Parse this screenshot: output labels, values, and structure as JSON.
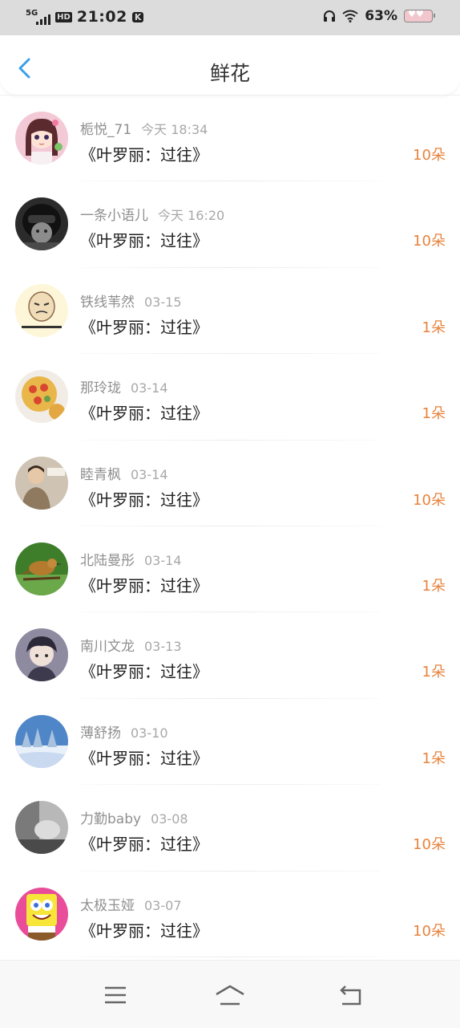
{
  "status": {
    "network": "5G",
    "hd": "HD",
    "time": "21:02",
    "k_badge": "K",
    "battery_pct": "63%"
  },
  "header": {
    "title": "鲜花"
  },
  "colors": {
    "accent_back": "#3aa0e8",
    "count_color": "#e8833c",
    "status_bg": "#dcdcdc"
  },
  "items": [
    {
      "name": "栀悦_71",
      "date": "今天 18:34",
      "book": "《叶罗丽：过往》",
      "count": "10朵",
      "avatar": "avatar-anime-girl"
    },
    {
      "name": "一条小语儿",
      "date": "今天 16:20",
      "book": "《叶罗丽：过往》",
      "count": "10朵",
      "avatar": "avatar-helmet-cat"
    },
    {
      "name": "铁线苇然",
      "date": "03-15",
      "book": "《叶罗丽：过往》",
      "count": "1朵",
      "avatar": "avatar-meme-face"
    },
    {
      "name": "那玲珑",
      "date": "03-14",
      "book": "《叶罗丽：过往》",
      "count": "1朵",
      "avatar": "avatar-pizza"
    },
    {
      "name": "睦青枫",
      "date": "03-14",
      "book": "《叶罗丽：过往》",
      "count": "10朵",
      "avatar": "avatar-man-photo"
    },
    {
      "name": "北陆曼彤",
      "date": "03-14",
      "book": "《叶罗丽：过往》",
      "count": "1朵",
      "avatar": "avatar-bird"
    },
    {
      "name": "南川文龙",
      "date": "03-13",
      "book": "《叶罗丽：过往》",
      "count": "1朵",
      "avatar": "avatar-anime-boy"
    },
    {
      "name": "薄舒扬",
      "date": "03-10",
      "book": "《叶罗丽：过往》",
      "count": "1朵",
      "avatar": "avatar-snow-forest"
    },
    {
      "name": "力勤baby",
      "date": "03-08",
      "book": "《叶罗丽：过往》",
      "count": "10朵",
      "avatar": "avatar-bw-photo"
    },
    {
      "name": "太极玉娅",
      "date": "03-07",
      "book": "《叶罗丽：过往》",
      "count": "10朵",
      "avatar": "avatar-spongebob"
    }
  ],
  "nav": {
    "menu": "menu-icon",
    "home": "home-icon",
    "back": "back-nav-icon"
  }
}
